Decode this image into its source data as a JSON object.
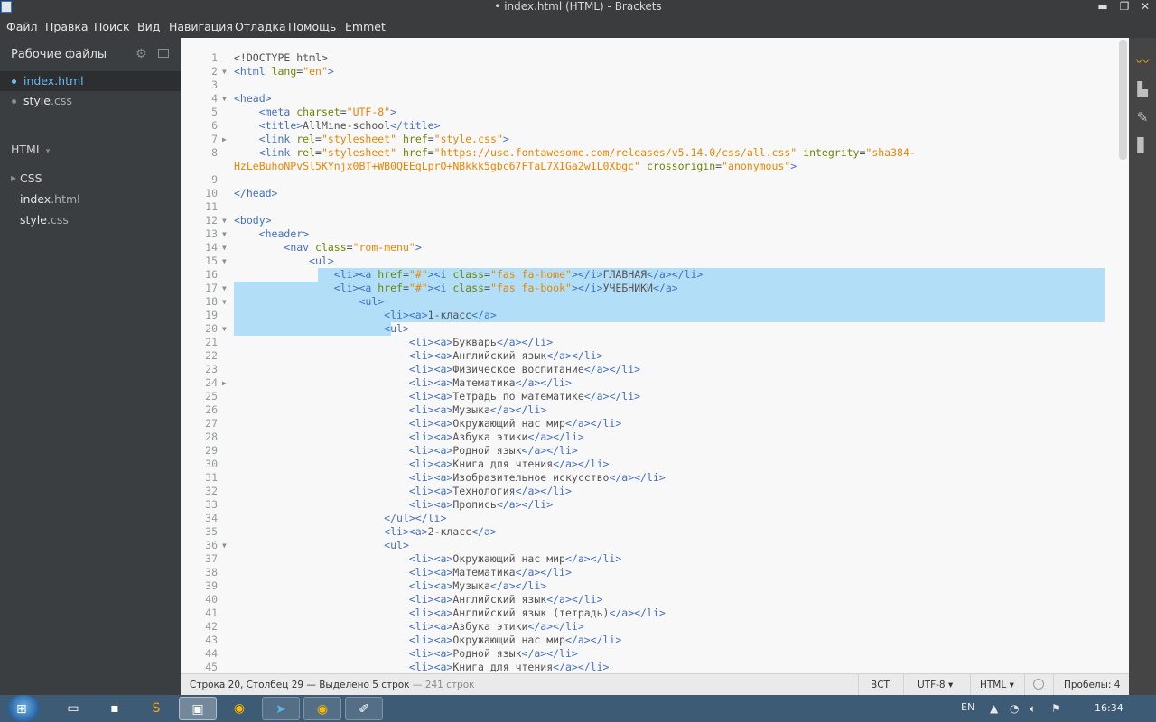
{
  "window": {
    "title": "• index.html (HTML) - Brackets",
    "minimize": "▬",
    "maximize": "❐",
    "close": "✕"
  },
  "menu": [
    "Файл",
    "Правка",
    "Поиск",
    "Вид",
    "Навигация",
    "Отладка",
    "Помощь",
    "Emmet"
  ],
  "sidebar": {
    "working_files_title": "Рабочие файлы",
    "working_files": [
      {
        "base": "index",
        "ext": ".html",
        "active": true
      },
      {
        "base": "style",
        "ext": ".css",
        "active": false
      }
    ],
    "project": "HTML",
    "tree": [
      {
        "type": "folder",
        "base": "CSS",
        "ext": ""
      },
      {
        "type": "file",
        "base": "index",
        "ext": ".html"
      },
      {
        "type": "file",
        "base": "style",
        "ext": ".css"
      }
    ]
  },
  "editor": {
    "lines": [
      {
        "n": "1",
        "fold": "",
        "code": [
          [
            "x",
            "<!DOCTYPE html>"
          ]
        ]
      },
      {
        "n": "2",
        "fold": "▼",
        "code": [
          [
            "t",
            "<html "
          ],
          [
            "a",
            "lang"
          ],
          [
            "x",
            "="
          ],
          [
            "s",
            "\"en\""
          ],
          [
            "t",
            ">"
          ]
        ]
      },
      {
        "n": "3",
        "fold": "",
        "code": []
      },
      {
        "n": "4",
        "fold": "▼",
        "code": [
          [
            "t",
            "<head>"
          ]
        ]
      },
      {
        "n": "5",
        "fold": "",
        "code": [
          [
            "x",
            "    "
          ],
          [
            "t",
            "<meta "
          ],
          [
            "a",
            "charset"
          ],
          [
            "x",
            "="
          ],
          [
            "s",
            "\"UTF-8\""
          ],
          [
            "t",
            ">"
          ]
        ]
      },
      {
        "n": "6",
        "fold": "",
        "code": [
          [
            "x",
            "    "
          ],
          [
            "t",
            "<title>"
          ],
          [
            "x",
            "AllMine-school"
          ],
          [
            "t",
            "</title>"
          ]
        ]
      },
      {
        "n": "7",
        "fold": "▶",
        "code": [
          [
            "x",
            "    "
          ],
          [
            "t",
            "<link "
          ],
          [
            "a",
            "rel"
          ],
          [
            "x",
            "="
          ],
          [
            "s",
            "\"stylesheet\""
          ],
          [
            "x",
            " "
          ],
          [
            "a",
            "href"
          ],
          [
            "x",
            "="
          ],
          [
            "s",
            "\"style.css\""
          ],
          [
            "t",
            ">"
          ]
        ]
      },
      {
        "n": "8",
        "fold": "",
        "code": [
          [
            "x",
            "    "
          ],
          [
            "t",
            "<link "
          ],
          [
            "a",
            "rel"
          ],
          [
            "x",
            "="
          ],
          [
            "s",
            "\"stylesheet\""
          ],
          [
            "x",
            " "
          ],
          [
            "a",
            "href"
          ],
          [
            "x",
            "="
          ],
          [
            "s",
            "\"https://use.fontawesome.com/releases/v5.14.0/css/all.css\""
          ],
          [
            "x",
            " "
          ],
          [
            "a",
            "integrity"
          ],
          [
            "x",
            "="
          ],
          [
            "s",
            "\"sha384-"
          ]
        ]
      },
      {
        "n": "",
        "fold": "",
        "code": [
          [
            "s",
            "HzLeBuhoNPvSl5KYnjx0BT+WB0QEEqLprO+NBkkk5gbc67FTaL7XIGa2w1L0Xbgc\""
          ],
          [
            "x",
            " "
          ],
          [
            "a",
            "crossorigin"
          ],
          [
            "x",
            "="
          ],
          [
            "s",
            "\"anonymous\""
          ],
          [
            "t",
            ">"
          ]
        ]
      },
      {
        "n": "9",
        "fold": "",
        "code": []
      },
      {
        "n": "10",
        "fold": "",
        "code": [
          [
            "t",
            "</head>"
          ]
        ]
      },
      {
        "n": "11",
        "fold": "",
        "code": []
      },
      {
        "n": "12",
        "fold": "▼",
        "code": [
          [
            "t",
            "<body>"
          ]
        ]
      },
      {
        "n": "13",
        "fold": "▼",
        "code": [
          [
            "x",
            "    "
          ],
          [
            "t",
            "<header>"
          ]
        ]
      },
      {
        "n": "14",
        "fold": "▼",
        "code": [
          [
            "x",
            "        "
          ],
          [
            "t",
            "<nav "
          ],
          [
            "a",
            "class"
          ],
          [
            "x",
            "="
          ],
          [
            "s",
            "\"rom-menu\""
          ],
          [
            "t",
            ">"
          ]
        ]
      },
      {
        "n": "15",
        "fold": "▼",
        "code": [
          [
            "x",
            "            "
          ],
          [
            "t",
            "<ul>"
          ]
        ]
      },
      {
        "n": "16",
        "fold": "",
        "code": [
          [
            "x",
            "                "
          ],
          [
            "t",
            "<li><a "
          ],
          [
            "a",
            "href"
          ],
          [
            "x",
            "="
          ],
          [
            "s",
            "\"#\""
          ],
          [
            "t",
            "><i "
          ],
          [
            "a",
            "class"
          ],
          [
            "x",
            "="
          ],
          [
            "s",
            "\"fas fa-home\""
          ],
          [
            "t",
            "></i>"
          ],
          [
            "x",
            "ГЛАВНАЯ"
          ],
          [
            "t",
            "</a></li>"
          ]
        ]
      },
      {
        "n": "17",
        "fold": "▼",
        "code": [
          [
            "x",
            "                "
          ],
          [
            "t",
            "<li><a "
          ],
          [
            "a",
            "href"
          ],
          [
            "x",
            "="
          ],
          [
            "s",
            "\"#\""
          ],
          [
            "t",
            "><i "
          ],
          [
            "a",
            "class"
          ],
          [
            "x",
            "="
          ],
          [
            "s",
            "\"fas fa-book\""
          ],
          [
            "t",
            "></i>"
          ],
          [
            "x",
            "УЧЕБНИКИ"
          ],
          [
            "t",
            "</a>"
          ]
        ]
      },
      {
        "n": "18",
        "fold": "▼",
        "code": [
          [
            "x",
            "                    "
          ],
          [
            "t",
            "<ul>"
          ]
        ]
      },
      {
        "n": "19",
        "fold": "",
        "code": [
          [
            "x",
            "                        "
          ],
          [
            "t",
            "<li><a>"
          ],
          [
            "x",
            "1-класс"
          ],
          [
            "t",
            "</a>"
          ]
        ]
      },
      {
        "n": "20",
        "fold": "▼",
        "code": [
          [
            "x",
            "                        "
          ],
          [
            "t",
            "<ul>"
          ]
        ]
      },
      {
        "n": "21",
        "fold": "",
        "code": [
          [
            "x",
            "                            "
          ],
          [
            "t",
            "<li><a>"
          ],
          [
            "x",
            "Букварь"
          ],
          [
            "t",
            "</a></li>"
          ]
        ]
      },
      {
        "n": "22",
        "fold": "",
        "code": [
          [
            "x",
            "                            "
          ],
          [
            "t",
            "<li><a>"
          ],
          [
            "x",
            "Английский язык"
          ],
          [
            "t",
            "</a></li>"
          ]
        ]
      },
      {
        "n": "23",
        "fold": "",
        "code": [
          [
            "x",
            "                            "
          ],
          [
            "t",
            "<li><a>"
          ],
          [
            "x",
            "Физическое воспитание"
          ],
          [
            "t",
            "</a></li>"
          ]
        ]
      },
      {
        "n": "24",
        "fold": "▶",
        "code": [
          [
            "x",
            "                            "
          ],
          [
            "t",
            "<li><a>"
          ],
          [
            "x",
            "Математика"
          ],
          [
            "t",
            "</a></li>"
          ]
        ]
      },
      {
        "n": "25",
        "fold": "",
        "code": [
          [
            "x",
            "                            "
          ],
          [
            "t",
            "<li><a>"
          ],
          [
            "x",
            "Тетрадь по математике"
          ],
          [
            "t",
            "</a></li>"
          ]
        ]
      },
      {
        "n": "26",
        "fold": "",
        "code": [
          [
            "x",
            "                            "
          ],
          [
            "t",
            "<li><a>"
          ],
          [
            "x",
            "Музыка"
          ],
          [
            "t",
            "</a></li>"
          ]
        ]
      },
      {
        "n": "27",
        "fold": "",
        "code": [
          [
            "x",
            "                            "
          ],
          [
            "t",
            "<li><a>"
          ],
          [
            "x",
            "Окружающий нас мир"
          ],
          [
            "t",
            "</a></li>"
          ]
        ]
      },
      {
        "n": "28",
        "fold": "",
        "code": [
          [
            "x",
            "                            "
          ],
          [
            "t",
            "<li><a>"
          ],
          [
            "x",
            "Азбука этики"
          ],
          [
            "t",
            "</a></li>"
          ]
        ]
      },
      {
        "n": "29",
        "fold": "",
        "code": [
          [
            "x",
            "                            "
          ],
          [
            "t",
            "<li><a>"
          ],
          [
            "x",
            "Родной язык"
          ],
          [
            "t",
            "</a></li>"
          ]
        ]
      },
      {
        "n": "30",
        "fold": "",
        "code": [
          [
            "x",
            "                            "
          ],
          [
            "t",
            "<li><a>"
          ],
          [
            "x",
            "Книга для чтения"
          ],
          [
            "t",
            "</a></li>"
          ]
        ]
      },
      {
        "n": "31",
        "fold": "",
        "code": [
          [
            "x",
            "                            "
          ],
          [
            "t",
            "<li><a>"
          ],
          [
            "x",
            "Изобразительное искусство"
          ],
          [
            "t",
            "</a></li>"
          ]
        ]
      },
      {
        "n": "32",
        "fold": "",
        "code": [
          [
            "x",
            "                            "
          ],
          [
            "t",
            "<li><a>"
          ],
          [
            "x",
            "Технология"
          ],
          [
            "t",
            "</a></li>"
          ]
        ]
      },
      {
        "n": "33",
        "fold": "",
        "code": [
          [
            "x",
            "                            "
          ],
          [
            "t",
            "<li><a>"
          ],
          [
            "x",
            "Пропись"
          ],
          [
            "t",
            "</a></li>"
          ]
        ]
      },
      {
        "n": "34",
        "fold": "",
        "code": [
          [
            "x",
            "                        "
          ],
          [
            "t",
            "</ul></li>"
          ]
        ]
      },
      {
        "n": "35",
        "fold": "",
        "code": [
          [
            "x",
            "                        "
          ],
          [
            "t",
            "<li><a>"
          ],
          [
            "x",
            "2-класс"
          ],
          [
            "t",
            "</a>"
          ]
        ]
      },
      {
        "n": "36",
        "fold": "▼",
        "code": [
          [
            "x",
            "                        "
          ],
          [
            "t",
            "<ul>"
          ]
        ]
      },
      {
        "n": "37",
        "fold": "",
        "code": [
          [
            "x",
            "                            "
          ],
          [
            "t",
            "<li><a>"
          ],
          [
            "x",
            "Окружающий нас мир"
          ],
          [
            "t",
            "</a></li>"
          ]
        ]
      },
      {
        "n": "38",
        "fold": "",
        "code": [
          [
            "x",
            "                            "
          ],
          [
            "t",
            "<li><a>"
          ],
          [
            "x",
            "Математика"
          ],
          [
            "t",
            "</a></li>"
          ]
        ]
      },
      {
        "n": "39",
        "fold": "",
        "code": [
          [
            "x",
            "                            "
          ],
          [
            "t",
            "<li><a>"
          ],
          [
            "x",
            "Музыка"
          ],
          [
            "t",
            "</a></li>"
          ]
        ]
      },
      {
        "n": "40",
        "fold": "",
        "code": [
          [
            "x",
            "                            "
          ],
          [
            "t",
            "<li><a>"
          ],
          [
            "x",
            "Английский язык"
          ],
          [
            "t",
            "</a></li>"
          ]
        ]
      },
      {
        "n": "41",
        "fold": "",
        "code": [
          [
            "x",
            "                            "
          ],
          [
            "t",
            "<li><a>"
          ],
          [
            "x",
            "Английский язык (тетрадь)"
          ],
          [
            "t",
            "</a></li>"
          ]
        ]
      },
      {
        "n": "42",
        "fold": "",
        "code": [
          [
            "x",
            "                            "
          ],
          [
            "t",
            "<li><a>"
          ],
          [
            "x",
            "Азбука этики"
          ],
          [
            "t",
            "</a></li>"
          ]
        ]
      },
      {
        "n": "43",
        "fold": "",
        "code": [
          [
            "x",
            "                            "
          ],
          [
            "t",
            "<li><a>"
          ],
          [
            "x",
            "Окружающий нас мир"
          ],
          [
            "t",
            "</a></li>"
          ]
        ]
      },
      {
        "n": "44",
        "fold": "",
        "code": [
          [
            "x",
            "                            "
          ],
          [
            "t",
            "<li><a>"
          ],
          [
            "x",
            "Родной язык"
          ],
          [
            "t",
            "</a></li>"
          ]
        ]
      },
      {
        "n": "45",
        "fold": "",
        "code": [
          [
            "x",
            "                            "
          ],
          [
            "t",
            "<li><a>"
          ],
          [
            "x",
            "Книга для чтения"
          ],
          [
            "t",
            "</a></li>"
          ]
        ]
      }
    ]
  },
  "statusbar": {
    "cursor": "Строка 20, Столбец 29 — Выделено 5 строк",
    "total": "— 241 строк",
    "overwrite": "ВСТ",
    "encoding": "UTF-8",
    "language": "HTML",
    "indent": "Пробелы: 4",
    "dropdown_caret": "▾"
  },
  "taskbar": {
    "lang": "EN",
    "clock": "16:34"
  },
  "colors": {
    "tag": "#446fbd",
    "attribute": "#6d8600",
    "string": "#e88501",
    "selection": "#b2dff7"
  }
}
